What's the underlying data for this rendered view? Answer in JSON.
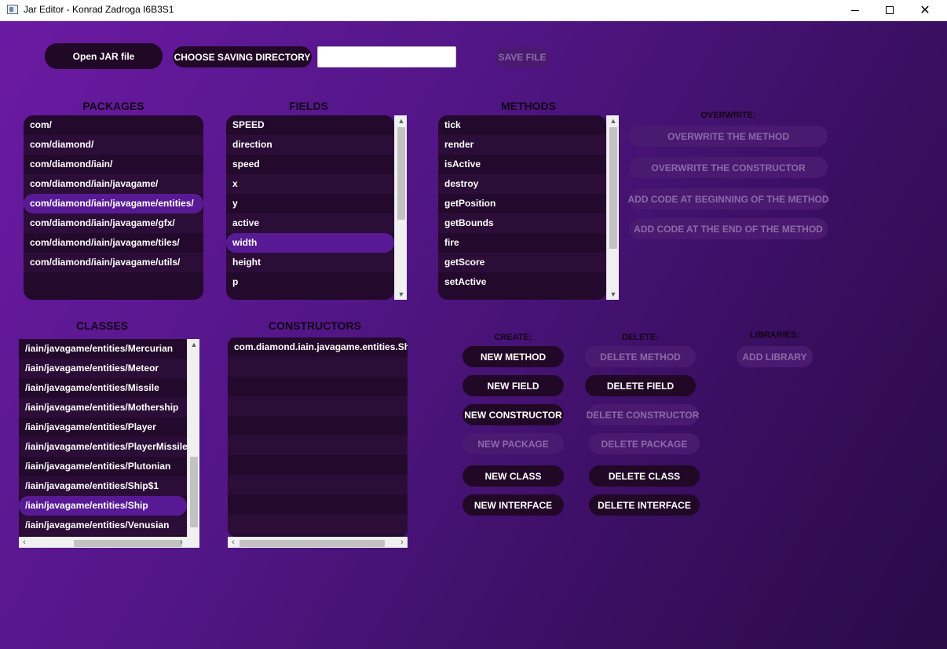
{
  "window": {
    "title": "Jar Editor - Konrad Zadroga I6B3S1"
  },
  "toolbar": {
    "open_jar": "Open JAR file",
    "choose_dir": "CHOOSE SAVING DIRECTORY",
    "saving_dir_value": "",
    "save_file": "SAVE FILE"
  },
  "headings": {
    "packages": "PACKAGES",
    "fields": "FIELDS",
    "methods": "METHODS",
    "classes": "CLASSES",
    "constructors": "CONSTRUCTORS",
    "overwrite": "OVERWRITE:",
    "create": "CREATE:",
    "delete": "DELETE:",
    "libraries": "LIBRARIES:"
  },
  "packages": [
    "com/",
    "com/diamond/",
    "com/diamond/iain/",
    "com/diamond/iain/javagame/",
    "com/diamond/iain/javagame/entities/",
    "com/diamond/iain/javagame/gfx/",
    "com/diamond/iain/javagame/tiles/",
    "com/diamond/iain/javagame/utils/"
  ],
  "fields": [
    "SPEED",
    "direction",
    "speed",
    "x",
    "y",
    "active",
    "width",
    "height",
    "p"
  ],
  "methods": [
    "tick",
    "render",
    "isActive",
    "destroy",
    "getPosition",
    "getBounds",
    "fire",
    "getScore",
    "setActive"
  ],
  "classes": [
    "/iain/javagame/entities/Mercurian",
    "/iain/javagame/entities/Meteor",
    "/iain/javagame/entities/Missile",
    "/iain/javagame/entities/Mothership",
    "/iain/javagame/entities/Player",
    "/iain/javagame/entities/PlayerMissile",
    "/iain/javagame/entities/Plutonian",
    "/iain/javagame/entities/Ship$1",
    "/iain/javagame/entities/Ship",
    "/iain/javagame/entities/Venusian"
  ],
  "constructors": [
    "com.diamond.iain.javagame.entities.Ship"
  ],
  "overwrite_actions": {
    "overwrite_method": "OVERWRITE THE METHOD",
    "overwrite_constructor": "OVERWRITE THE CONSTRUCTOR",
    "add_code_begin": "ADD CODE AT BEGINNING OF THE METHOD",
    "add_code_end": "ADD CODE AT THE END OF THE METHOD"
  },
  "create_actions": {
    "new_method": "NEW METHOD",
    "new_field": "NEW FIELD",
    "new_constructor": "NEW CONSTRUCTOR",
    "new_package": "NEW PACKAGE",
    "new_class": "NEW CLASS",
    "new_interface": "NEW INTERFACE"
  },
  "delete_actions": {
    "delete_method": "DELETE METHOD",
    "delete_field": "DELETE FIELD",
    "delete_constructor": "DELETE CONSTRUCTOR",
    "delete_package": "DELETE PACKAGE",
    "delete_class": "DELETE CLASS",
    "delete_interface": "DELETE INTERFACE"
  },
  "library_actions": {
    "add_library": "ADD LIBRARY"
  },
  "selected": {
    "package": "com/diamond/iain/javagame/entities/",
    "field": "width",
    "class": "/iain/javagame/entities/Ship"
  },
  "colors": {
    "accent": "#581a94",
    "button_dark": "#210826",
    "button_disabled": "#4a1a70",
    "list_bg": "#230a2c"
  }
}
